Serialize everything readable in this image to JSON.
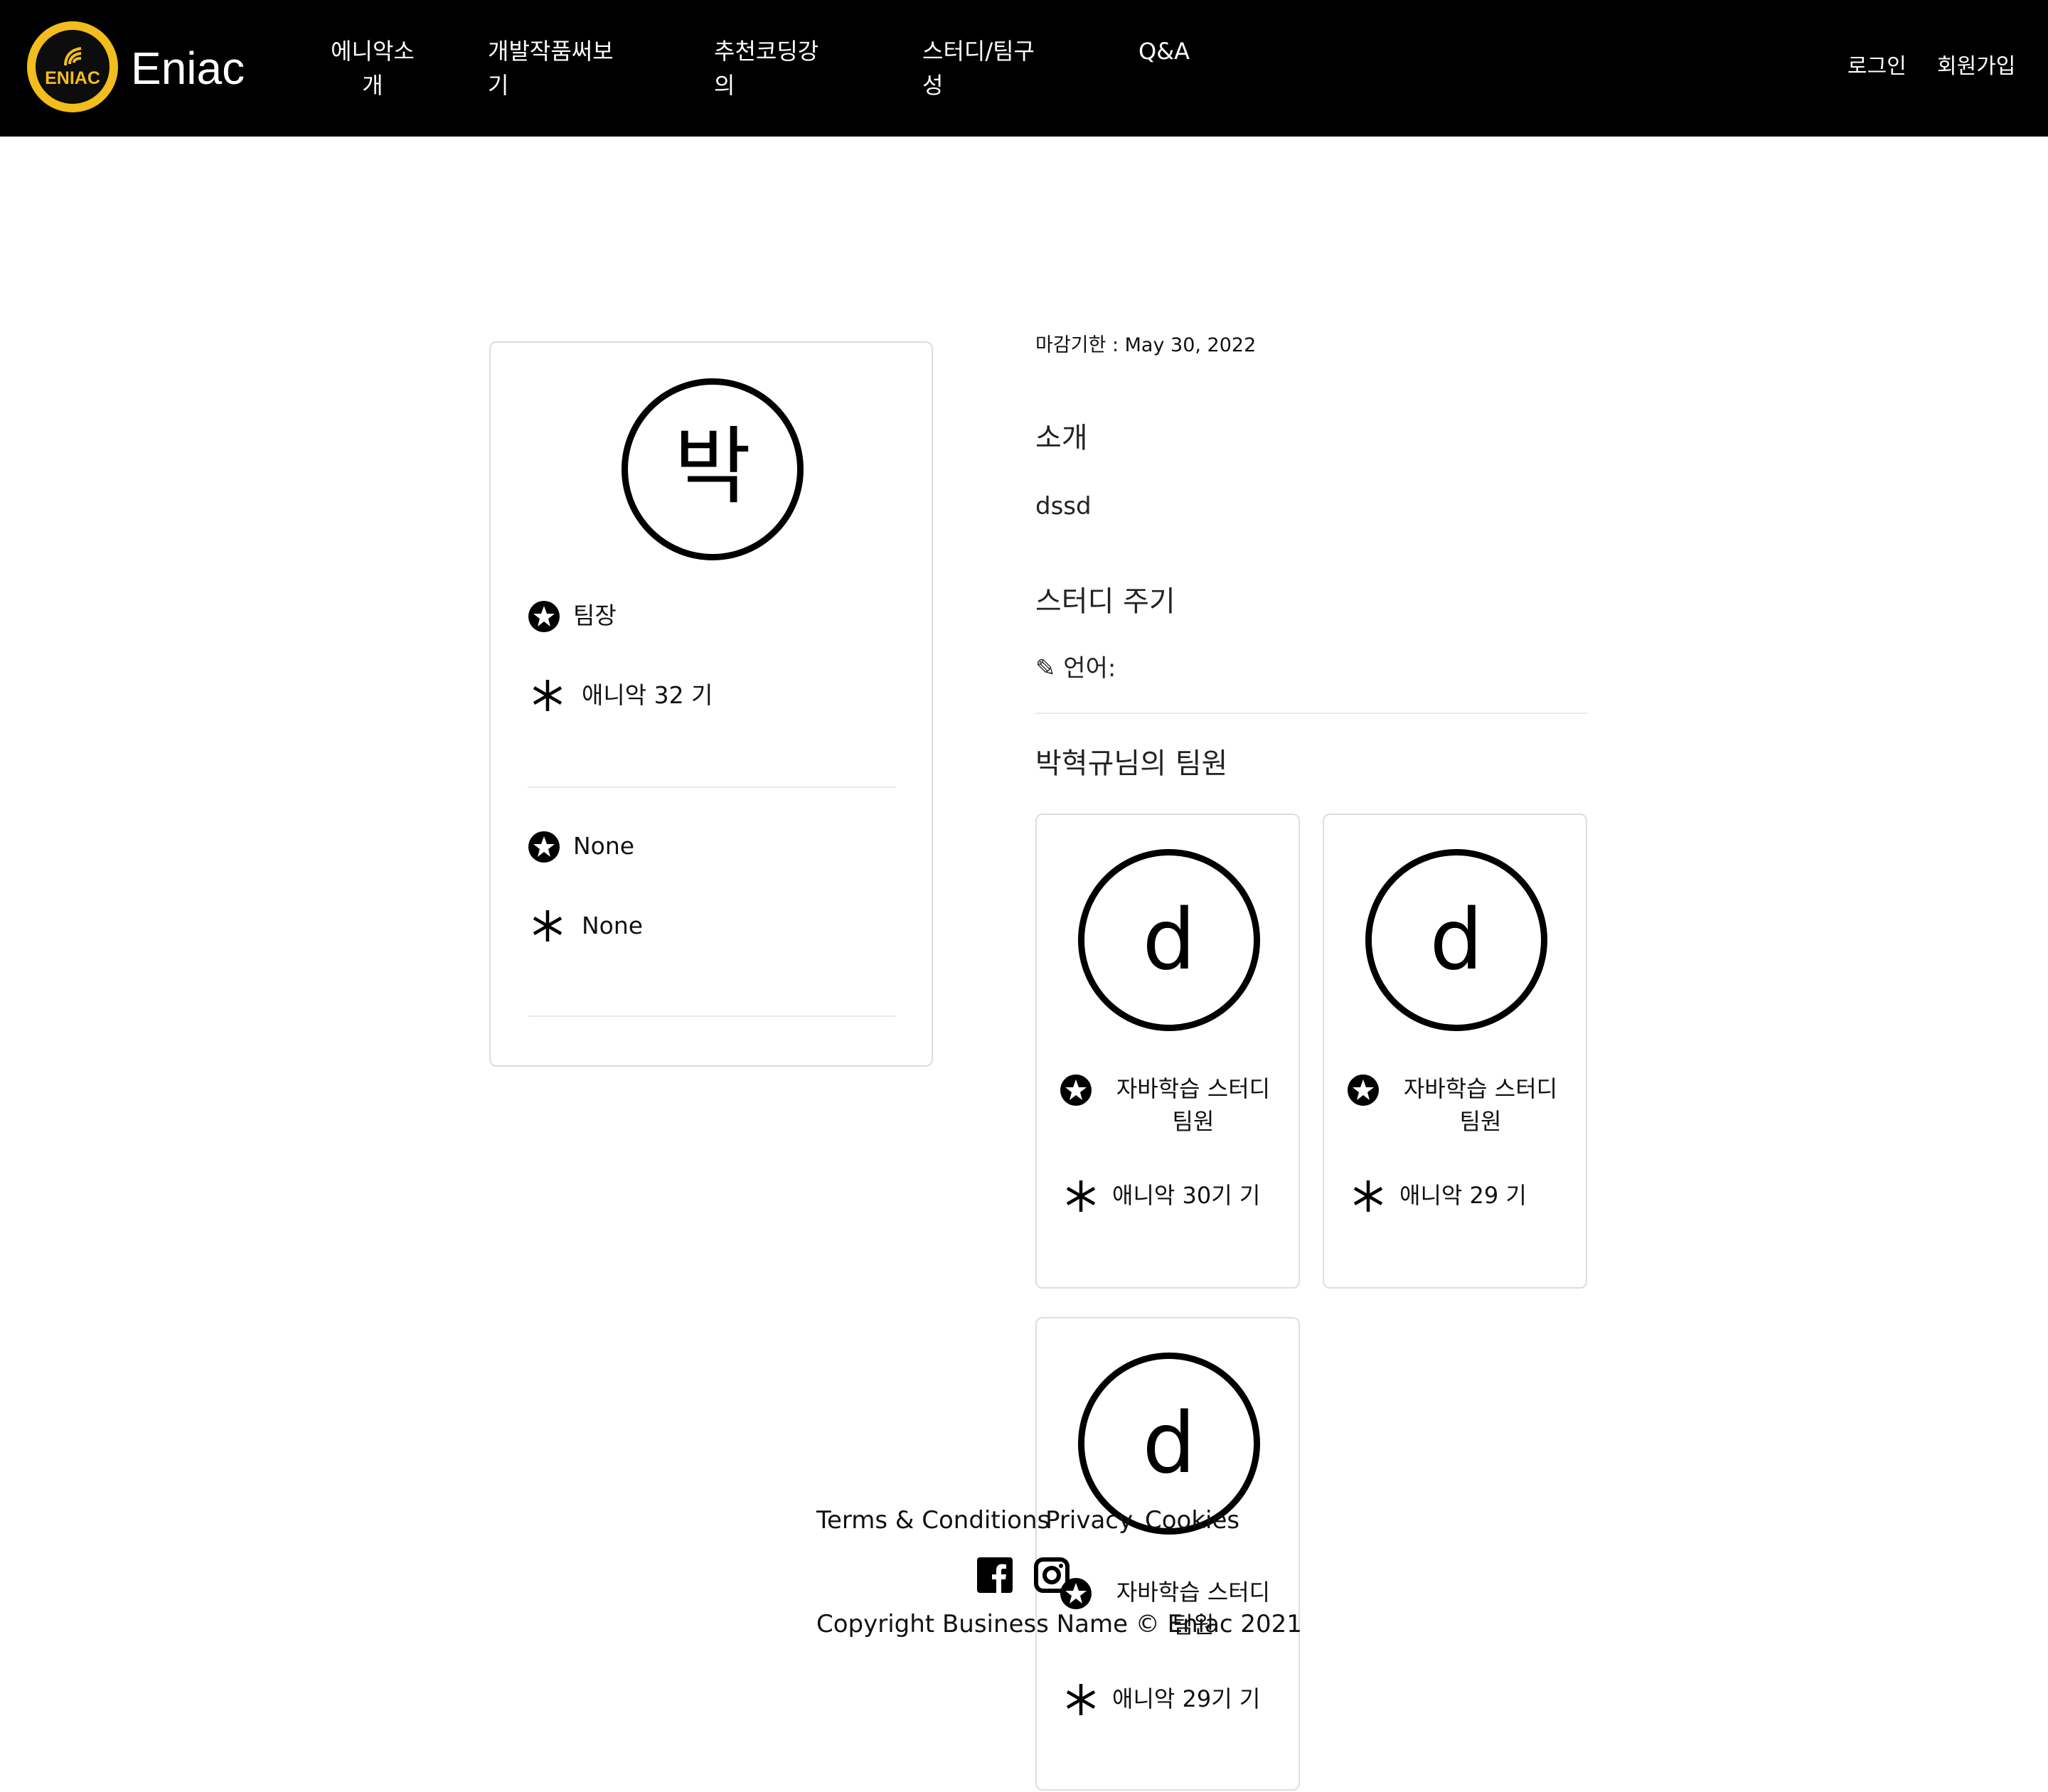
{
  "nav": {
    "brand": "Eniac",
    "logo_text": "ENIAC",
    "links": [
      {
        "line1": "에니악소",
        "line2": "개"
      },
      {
        "line1": "개발작품써보",
        "line2": "기"
      },
      {
        "line1": "추천코딩강",
        "line2": "의"
      },
      {
        "line1": "스터디/팀구",
        "line2": "성"
      },
      {
        "line1": "Q&A",
        "line2": ""
      }
    ],
    "login": "로그인",
    "signup": "회원가입"
  },
  "leader": {
    "avatar": "박",
    "role": "팀장",
    "generation": "애니악 32 기",
    "extra_role": "None",
    "extra_generation": "None"
  },
  "study": {
    "deadline": "마감기한 : May 30, 2022",
    "intro_title": "소개",
    "intro_text": "dssd",
    "period_title": "스터디 주기",
    "language": "✎ 언어:",
    "members_title": "박혁규님의 팀원"
  },
  "members": [
    {
      "avatar": "d",
      "role_line1": "자바학습 스터디",
      "role_line2": "팀원",
      "generation": "애니악 30기 기"
    },
    {
      "avatar": "d",
      "role_line1": "자바학습 스터디",
      "role_line2": "팀원",
      "generation": "애니악 29 기"
    },
    {
      "avatar": "d",
      "role_line1": "자바학습 스터디",
      "role_line2": "팀원",
      "generation": "애니악 29기 기"
    }
  ],
  "footer": {
    "terms": "Terms & Conditions",
    "privacy": "Privacy",
    "cookies": "Cookies",
    "copyright": "Copyright Business Name © Eniac 2021"
  },
  "colors": {
    "nav_bg": "#000000",
    "logo_gold": "#f2bd1d"
  }
}
